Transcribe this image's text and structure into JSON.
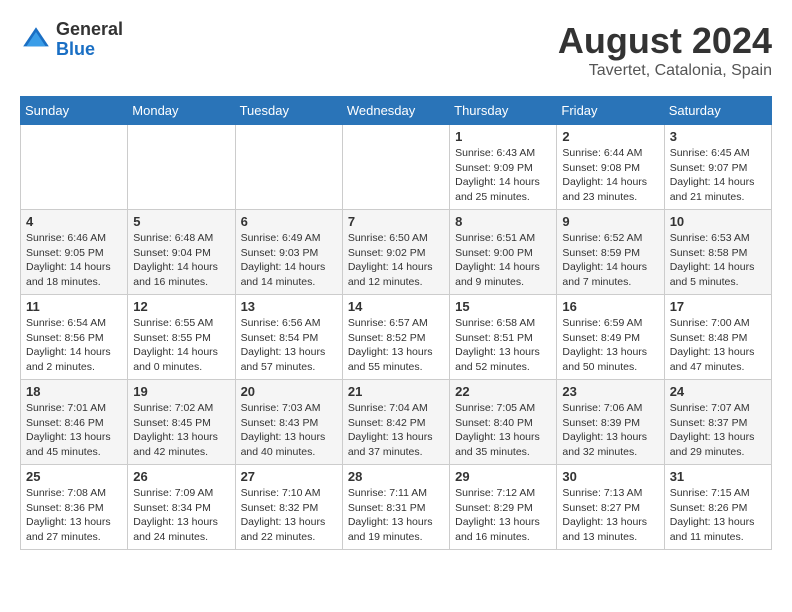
{
  "header": {
    "logo_general": "General",
    "logo_blue": "Blue",
    "month_year": "August 2024",
    "location": "Tavertet, Catalonia, Spain"
  },
  "weekdays": [
    "Sunday",
    "Monday",
    "Tuesday",
    "Wednesday",
    "Thursday",
    "Friday",
    "Saturday"
  ],
  "weeks": [
    [
      {
        "day": "",
        "info": ""
      },
      {
        "day": "",
        "info": ""
      },
      {
        "day": "",
        "info": ""
      },
      {
        "day": "",
        "info": ""
      },
      {
        "day": "1",
        "info": "Sunrise: 6:43 AM\nSunset: 9:09 PM\nDaylight: 14 hours and 25 minutes."
      },
      {
        "day": "2",
        "info": "Sunrise: 6:44 AM\nSunset: 9:08 PM\nDaylight: 14 hours and 23 minutes."
      },
      {
        "day": "3",
        "info": "Sunrise: 6:45 AM\nSunset: 9:07 PM\nDaylight: 14 hours and 21 minutes."
      }
    ],
    [
      {
        "day": "4",
        "info": "Sunrise: 6:46 AM\nSunset: 9:05 PM\nDaylight: 14 hours and 18 minutes."
      },
      {
        "day": "5",
        "info": "Sunrise: 6:48 AM\nSunset: 9:04 PM\nDaylight: 14 hours and 16 minutes."
      },
      {
        "day": "6",
        "info": "Sunrise: 6:49 AM\nSunset: 9:03 PM\nDaylight: 14 hours and 14 minutes."
      },
      {
        "day": "7",
        "info": "Sunrise: 6:50 AM\nSunset: 9:02 PM\nDaylight: 14 hours and 12 minutes."
      },
      {
        "day": "8",
        "info": "Sunrise: 6:51 AM\nSunset: 9:00 PM\nDaylight: 14 hours and 9 minutes."
      },
      {
        "day": "9",
        "info": "Sunrise: 6:52 AM\nSunset: 8:59 PM\nDaylight: 14 hours and 7 minutes."
      },
      {
        "day": "10",
        "info": "Sunrise: 6:53 AM\nSunset: 8:58 PM\nDaylight: 14 hours and 5 minutes."
      }
    ],
    [
      {
        "day": "11",
        "info": "Sunrise: 6:54 AM\nSunset: 8:56 PM\nDaylight: 14 hours and 2 minutes."
      },
      {
        "day": "12",
        "info": "Sunrise: 6:55 AM\nSunset: 8:55 PM\nDaylight: 14 hours and 0 minutes."
      },
      {
        "day": "13",
        "info": "Sunrise: 6:56 AM\nSunset: 8:54 PM\nDaylight: 13 hours and 57 minutes."
      },
      {
        "day": "14",
        "info": "Sunrise: 6:57 AM\nSunset: 8:52 PM\nDaylight: 13 hours and 55 minutes."
      },
      {
        "day": "15",
        "info": "Sunrise: 6:58 AM\nSunset: 8:51 PM\nDaylight: 13 hours and 52 minutes."
      },
      {
        "day": "16",
        "info": "Sunrise: 6:59 AM\nSunset: 8:49 PM\nDaylight: 13 hours and 50 minutes."
      },
      {
        "day": "17",
        "info": "Sunrise: 7:00 AM\nSunset: 8:48 PM\nDaylight: 13 hours and 47 minutes."
      }
    ],
    [
      {
        "day": "18",
        "info": "Sunrise: 7:01 AM\nSunset: 8:46 PM\nDaylight: 13 hours and 45 minutes."
      },
      {
        "day": "19",
        "info": "Sunrise: 7:02 AM\nSunset: 8:45 PM\nDaylight: 13 hours and 42 minutes."
      },
      {
        "day": "20",
        "info": "Sunrise: 7:03 AM\nSunset: 8:43 PM\nDaylight: 13 hours and 40 minutes."
      },
      {
        "day": "21",
        "info": "Sunrise: 7:04 AM\nSunset: 8:42 PM\nDaylight: 13 hours and 37 minutes."
      },
      {
        "day": "22",
        "info": "Sunrise: 7:05 AM\nSunset: 8:40 PM\nDaylight: 13 hours and 35 minutes."
      },
      {
        "day": "23",
        "info": "Sunrise: 7:06 AM\nSunset: 8:39 PM\nDaylight: 13 hours and 32 minutes."
      },
      {
        "day": "24",
        "info": "Sunrise: 7:07 AM\nSunset: 8:37 PM\nDaylight: 13 hours and 29 minutes."
      }
    ],
    [
      {
        "day": "25",
        "info": "Sunrise: 7:08 AM\nSunset: 8:36 PM\nDaylight: 13 hours and 27 minutes."
      },
      {
        "day": "26",
        "info": "Sunrise: 7:09 AM\nSunset: 8:34 PM\nDaylight: 13 hours and 24 minutes."
      },
      {
        "day": "27",
        "info": "Sunrise: 7:10 AM\nSunset: 8:32 PM\nDaylight: 13 hours and 22 minutes."
      },
      {
        "day": "28",
        "info": "Sunrise: 7:11 AM\nSunset: 8:31 PM\nDaylight: 13 hours and 19 minutes."
      },
      {
        "day": "29",
        "info": "Sunrise: 7:12 AM\nSunset: 8:29 PM\nDaylight: 13 hours and 16 minutes."
      },
      {
        "day": "30",
        "info": "Sunrise: 7:13 AM\nSunset: 8:27 PM\nDaylight: 13 hours and 13 minutes."
      },
      {
        "day": "31",
        "info": "Sunrise: 7:15 AM\nSunset: 8:26 PM\nDaylight: 13 hours and 11 minutes."
      }
    ]
  ]
}
